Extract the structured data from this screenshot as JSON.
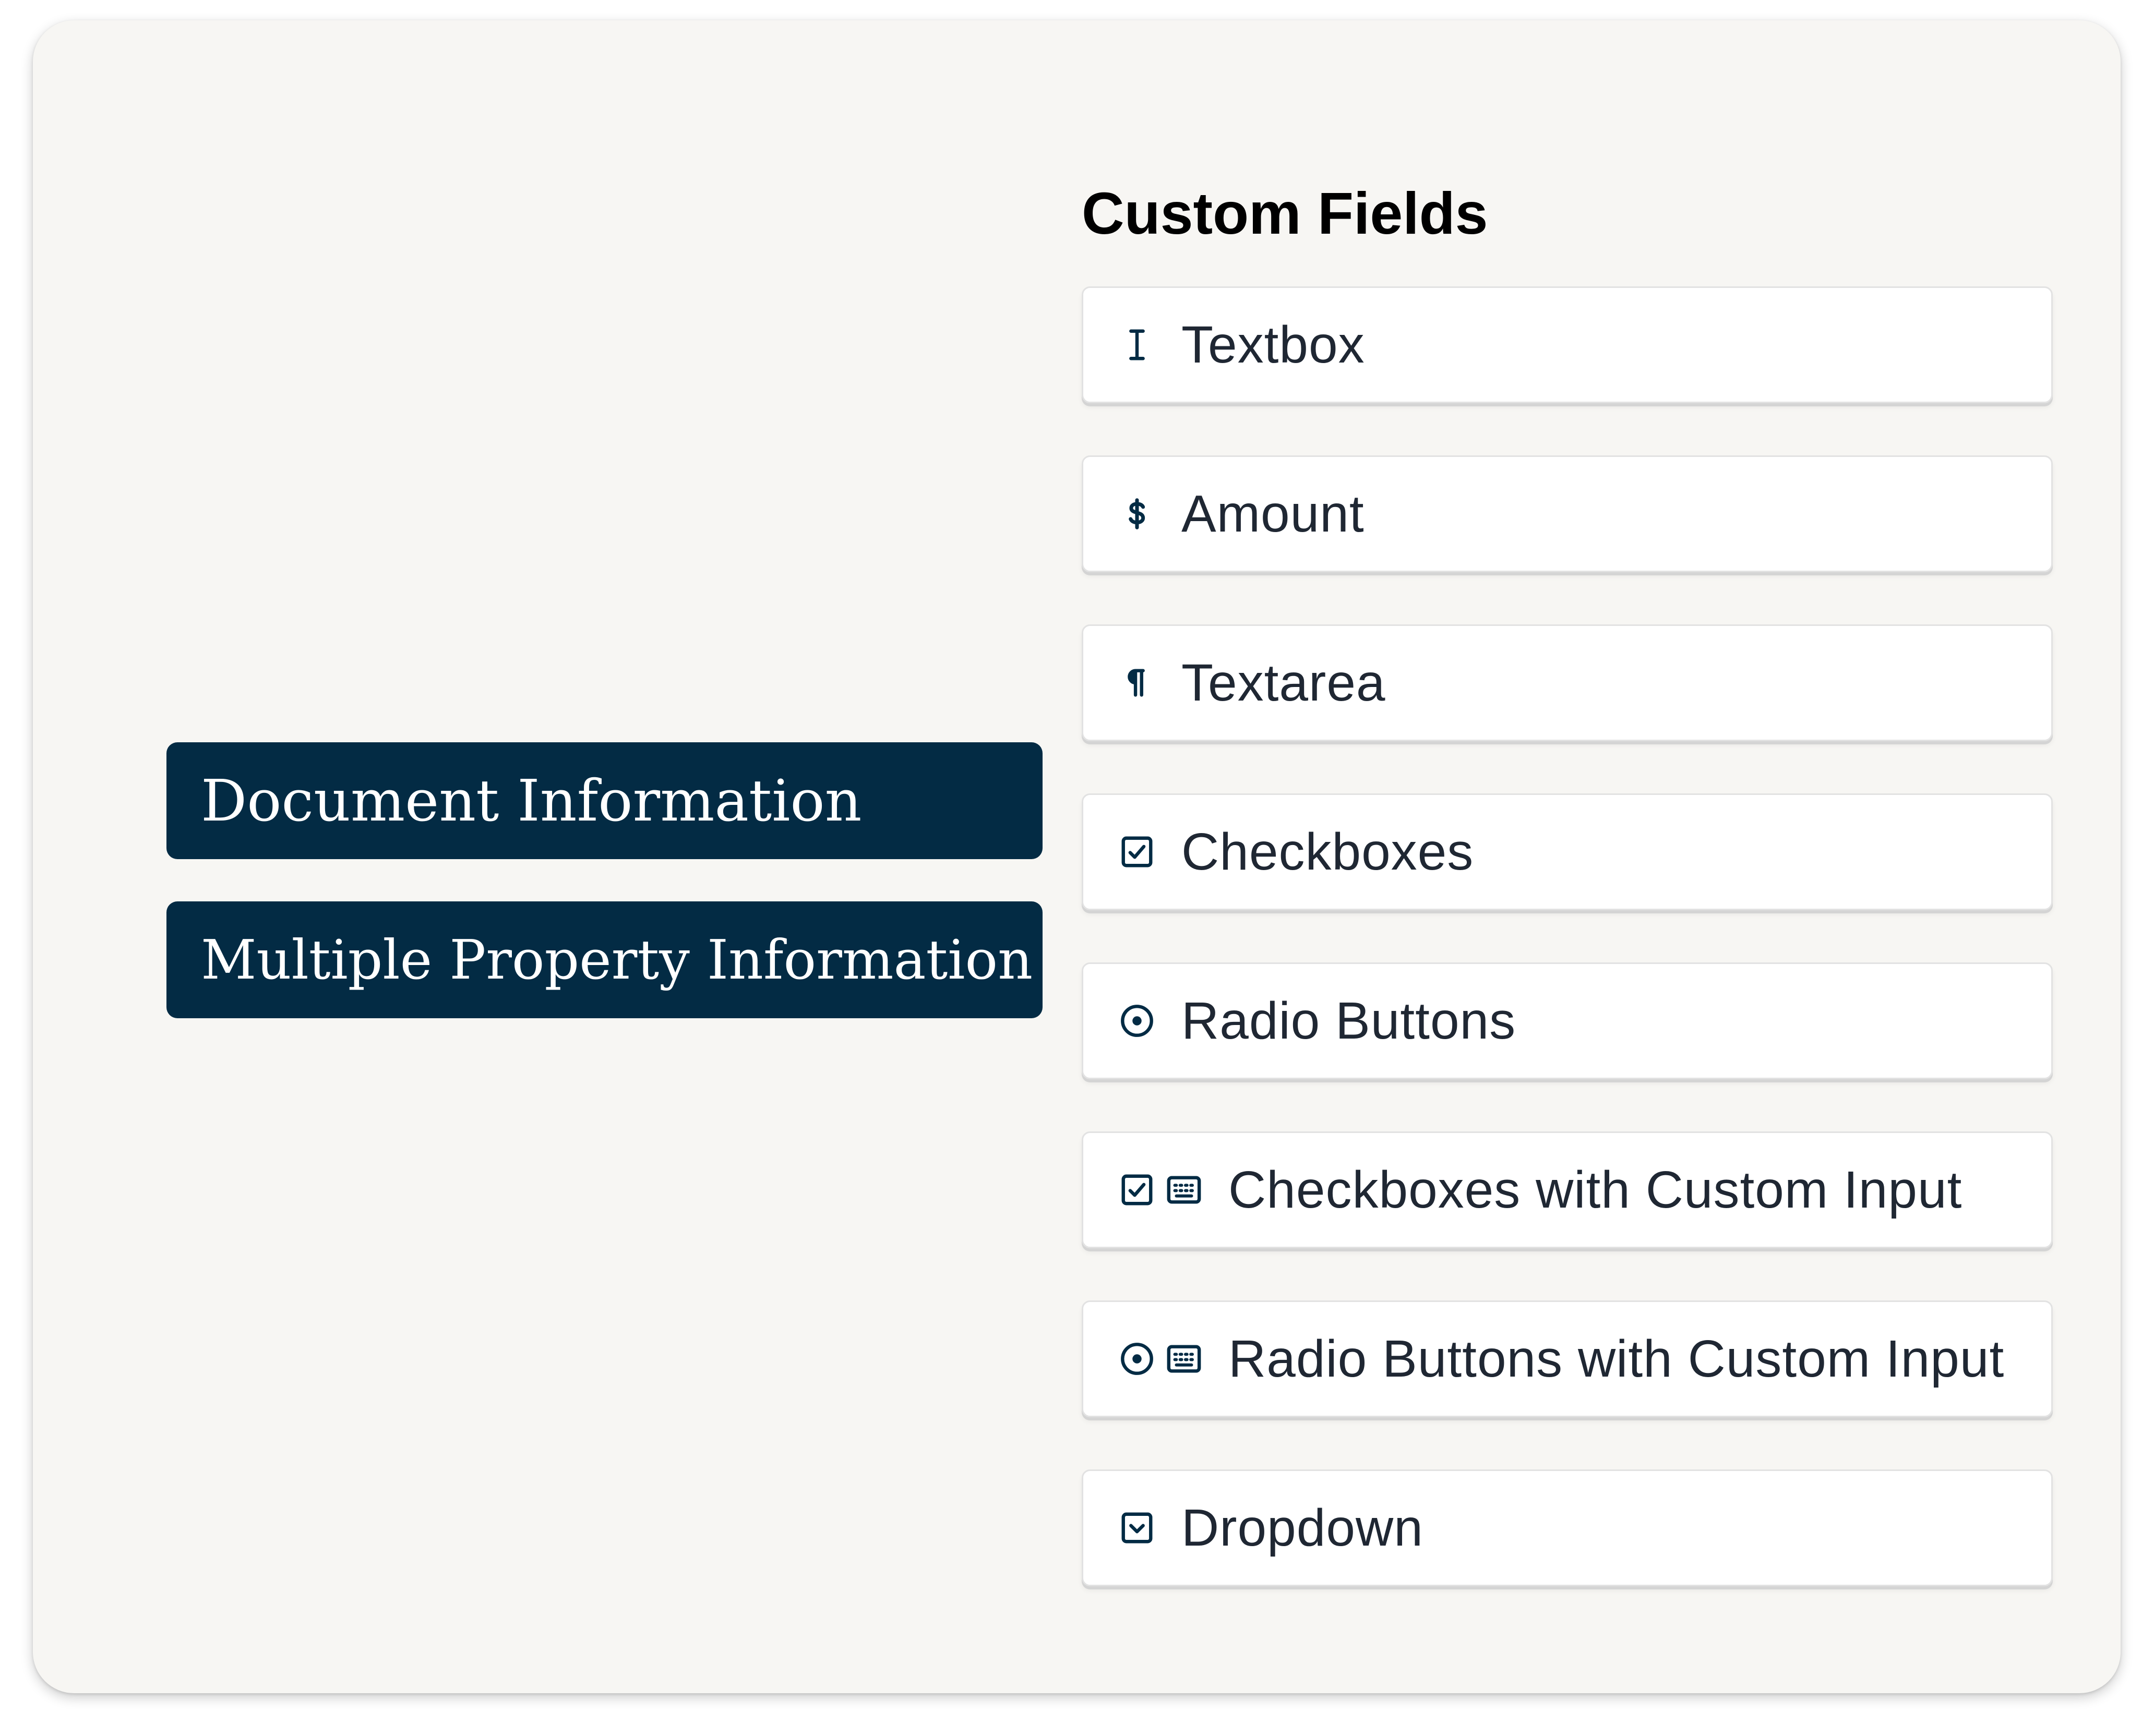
{
  "sections": {
    "document_information": "Document Information",
    "multiple_property_information": "Multiple Property Information"
  },
  "custom_fields": {
    "title": "Custom Fields",
    "items": [
      {
        "label": "Textbox",
        "icons": [
          "text-cursor-icon"
        ]
      },
      {
        "label": "Amount",
        "icons": [
          "dollar-icon"
        ]
      },
      {
        "label": "Textarea",
        "icons": [
          "paragraph-icon"
        ]
      },
      {
        "label": "Checkboxes",
        "icons": [
          "checkbox-icon"
        ]
      },
      {
        "label": "Radio Buttons",
        "icons": [
          "radio-icon"
        ]
      },
      {
        "label": "Checkboxes with Custom Input",
        "icons": [
          "checkbox-icon",
          "keyboard-icon"
        ]
      },
      {
        "label": "Radio Buttons with Custom Input",
        "icons": [
          "radio-icon",
          "keyboard-icon"
        ]
      },
      {
        "label": "Dropdown",
        "icons": [
          "dropdown-icon"
        ]
      }
    ]
  },
  "colors": {
    "section_button_bg": "#032b44",
    "card_bg": "#f7f6f3",
    "icon_color": "#032b44"
  }
}
